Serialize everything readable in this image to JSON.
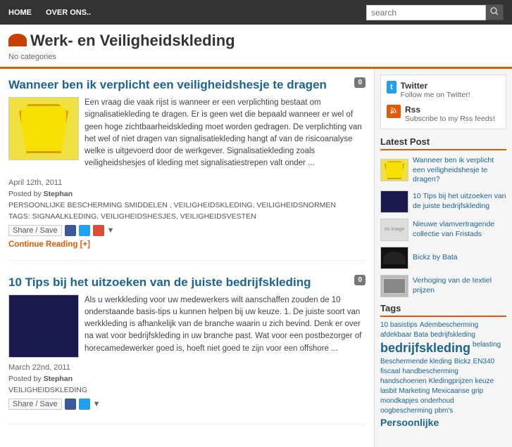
{
  "nav": {
    "items": [
      {
        "label": "HOME",
        "id": "home"
      },
      {
        "label": "OVER ONS..",
        "id": "about"
      }
    ]
  },
  "search": {
    "placeholder": "search",
    "button_label": "🔍"
  },
  "header": {
    "title": "Werk- en Veiligheidskleding",
    "categories_label": "No categories"
  },
  "articles": [
    {
      "id": "article-1",
      "title": "Wanneer ben ik verplicht een veiligheidshesje te dragen",
      "comment_count": "0",
      "date": "April 12th, 2011",
      "posted_by": "Stephan",
      "categories": "PERSOONLIJKE BESCHERMING SMIDDELEN , VEILIGHEIDSKLEDING, VEILIGHEIDSNORMEN",
      "tags": "SIGNAALKLEDING, VEILIGHEIDSHESJES, VEILIGHEIDSVESTEN",
      "body": "Een vraag die vaak rijst is wanneer er een verplichting bestaat om signalisatiekleding te dragen. Er is geen wet die bepaald wanneer er wel of geen hoge zichtbaarheidskleding moet worden gedragen.\nDe verplichting van het wel of niet dragen van signalisatiekleding hangt af van de risicoanalyse welke is uitgevoerd door de werkgever.\nSignalisatiekleding zoals veiligheidshesjes of kleding met signalisatiestrepen valt onder ...",
      "continue_reading": "Continue Reading [+]",
      "share_label": "Share / Save"
    },
    {
      "id": "article-2",
      "title": "10 Tips bij het uitzoeken van de juiste bedrijfskleding",
      "comment_count": "0",
      "date": "March 22nd, 2011",
      "posted_by": "Stephan",
      "categories": "VEILIGHEIDSKLEDING",
      "tags": "",
      "body": "Als u werkkleding voor uw medewerkers wilt aanschaffen zouden de 10 onderstaande basis-tips u kunnen helpen bij uw keuze.\n1. De juiste soort van werkkleding is afhankelijk van de branche waarin u zich bevind. Denk er over na wat voor bedrijfskleding in uw branche past. Wat voor een postbezorger of horecamedewerker goed is, hoeft niet goed te zijn voor een offshore ...",
      "share_label": "Share / Save"
    }
  ],
  "sidebar": {
    "twitter": {
      "icon": "t",
      "title": "Twitter",
      "subtitle": "Follow me on Twitter!"
    },
    "rss": {
      "icon": "rss",
      "title": "Rss",
      "subtitle": "Subscribe to my Rss feeds!"
    },
    "latest_posts_title": "Latest Post",
    "latest_posts": [
      {
        "id": "lp-1",
        "text": "Wanneer ben ik verplicht een veiligheidshesje te dragen?",
        "thumb_type": "vest"
      },
      {
        "id": "lp-2",
        "text": "10 Tips bij het uitzoeken van de juiste bedrijfskleding",
        "thumb_type": "suit"
      },
      {
        "id": "lp-3",
        "text": "Nieuwe vlamvertragende collectie van Fristads",
        "thumb_type": "noimage"
      },
      {
        "id": "lp-4",
        "text": "Bickz by Bata",
        "thumb_type": "shoe"
      },
      {
        "id": "lp-5",
        "text": "Verhoging van de textiel prijzen",
        "thumb_type": "stripe"
      }
    ],
    "tags_title": "Tags",
    "tags": [
      {
        "label": "10 basistips",
        "size": "small"
      },
      {
        "label": "Adembescherming",
        "size": "small"
      },
      {
        "label": "afdekbaar",
        "size": "small"
      },
      {
        "label": "Bata",
        "size": "small"
      },
      {
        "label": "bedrijfskleding",
        "size": "small"
      },
      {
        "label": "bedrijfskleding",
        "size": "xlarge"
      },
      {
        "label": "belasting",
        "size": "small"
      },
      {
        "label": "Beschermende kleding",
        "size": "small"
      },
      {
        "label": "Bickz",
        "size": "small"
      },
      {
        "label": "EN340",
        "size": "small"
      },
      {
        "label": "fiscaal",
        "size": "small"
      },
      {
        "label": "handbescherming",
        "size": "small"
      },
      {
        "label": "handschoenen",
        "size": "small"
      },
      {
        "label": "Kledingprijzen",
        "size": "small"
      },
      {
        "label": "keuze",
        "size": "small"
      },
      {
        "label": "lasbit",
        "size": "small"
      },
      {
        "label": "Marketing",
        "size": "small"
      },
      {
        "label": "Mexicaanse grip",
        "size": "small"
      },
      {
        "label": "mondkapjes",
        "size": "small"
      },
      {
        "label": "onderhoud",
        "size": "small"
      },
      {
        "label": "oogbescherming",
        "size": "small"
      },
      {
        "label": "pbm's",
        "size": "small"
      },
      {
        "label": "Persoonlijke",
        "size": "large"
      }
    ]
  }
}
